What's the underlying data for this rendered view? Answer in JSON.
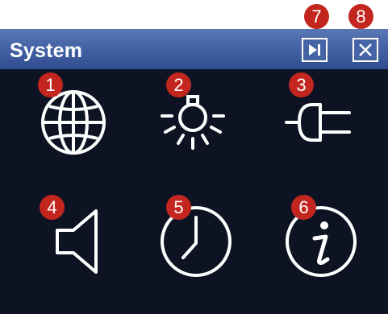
{
  "window": {
    "title": "System",
    "colors": {
      "titlebar": "#4564a6",
      "panel": "#0d1322",
      "badge": "#c3261f",
      "icon": "#ffffff"
    }
  },
  "toolbar": {
    "next": {
      "icon": "skip-next-icon",
      "badge": "7"
    },
    "close": {
      "icon": "close-icon",
      "badge": "8"
    }
  },
  "items": [
    {
      "icon": "globe-icon",
      "badge": "1"
    },
    {
      "icon": "lightbulb-icon",
      "badge": "2"
    },
    {
      "icon": "power-plug-icon",
      "badge": "3"
    },
    {
      "icon": "speaker-icon",
      "badge": "4"
    },
    {
      "icon": "clock-icon",
      "badge": "5"
    },
    {
      "icon": "info-icon",
      "badge": "6"
    }
  ]
}
